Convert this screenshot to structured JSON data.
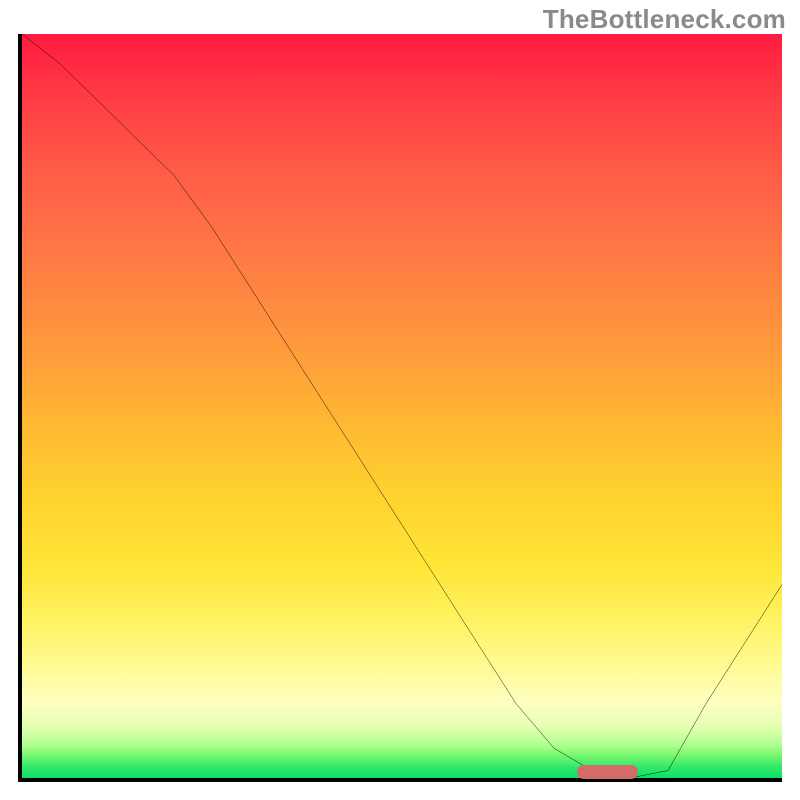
{
  "watermark": "TheBottleneck.com",
  "colors": {
    "border": "#000000",
    "watermark_text": "#8a8a8a",
    "marker": "#d46a6a",
    "curve": "#000000"
  },
  "chart_data": {
    "type": "line",
    "title": "",
    "xlabel": "",
    "ylabel": "",
    "xlim": [
      0,
      100
    ],
    "ylim": [
      0,
      100
    ],
    "grid": false,
    "legend": "none",
    "series": [
      {
        "name": "bottleneck-curve",
        "x": [
          0,
          5,
          10,
          15,
          20,
          25,
          30,
          35,
          40,
          45,
          50,
          55,
          60,
          65,
          70,
          75,
          80,
          85,
          90,
          95,
          100
        ],
        "y": [
          100,
          96,
          91,
          86,
          81,
          74,
          66,
          58,
          50,
          42,
          34,
          26,
          18,
          10,
          4,
          1,
          0,
          1,
          10,
          18,
          26
        ]
      }
    ],
    "marker": {
      "x_center": 77,
      "width": 8,
      "y": 0.5,
      "color": "#d46a6a"
    },
    "background_gradient": {
      "type": "vertical",
      "stops": [
        {
          "pos": 0.0,
          "color": "#ff1a3f"
        },
        {
          "pos": 0.3,
          "color": "#ff7a44"
        },
        {
          "pos": 0.62,
          "color": "#ffd22e"
        },
        {
          "pos": 0.86,
          "color": "#fffb9c"
        },
        {
          "pos": 1.0,
          "color": "#0ee066"
        }
      ]
    }
  }
}
